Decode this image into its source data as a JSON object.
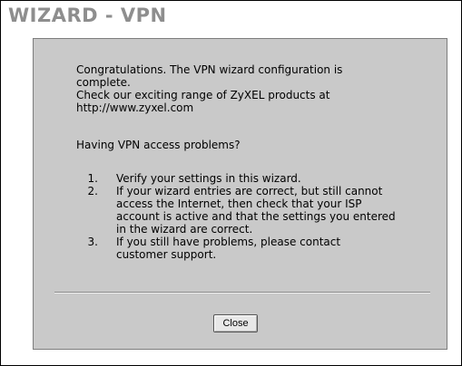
{
  "window": {
    "title": "WIZARD - VPN"
  },
  "message": {
    "congrats_line1": "Congratulations. The VPN wizard configuration is",
    "congrats_line2": "complete.",
    "check_line1": "Check our exciting range of ZyXEL products at",
    "check_line2": "http://www.zyxel.com",
    "problem_heading": "Having VPN access problems?"
  },
  "steps": [
    {
      "number": "1.",
      "lines": [
        "Verify your settings in this wizard."
      ]
    },
    {
      "number": "2.",
      "lines": [
        "If your wizard entries are correct, but still cannot",
        "access the Internet, then check that your ISP",
        "account is active and that the settings you entered",
        "in the wizard are correct."
      ]
    },
    {
      "number": "3.",
      "lines": [
        "If you still have problems, please contact",
        "customer support."
      ]
    }
  ],
  "buttons": {
    "close_label": "Close"
  }
}
